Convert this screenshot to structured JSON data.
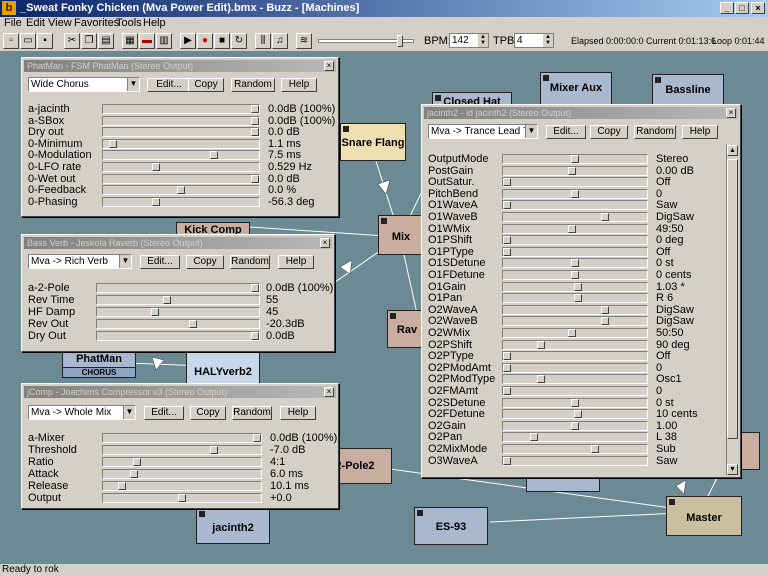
{
  "window": {
    "title": "_Sweat Fonky Chicken (Mva Power Edit).bmx - Buzz - [Machines]"
  },
  "menu": [
    "File",
    "Edit",
    "View",
    "Favorites",
    "Tools",
    "Help"
  ],
  "toolbar": {
    "bpm_label": "BPM:",
    "bpm_value": "142",
    "tpb_label": "TPB:",
    "tpb_value": "4",
    "elapsed": "Elapsed 0:00:00:0",
    "current": "Current 0:01:13:6",
    "loop": "Loop 0:01:44"
  },
  "machines": [
    {
      "name": "Mixer Aux",
      "kind": "gen"
    },
    {
      "name": "Bassline",
      "kind": "gen"
    },
    {
      "name": "Snare Flang",
      "kind": "effect"
    },
    {
      "name": "Mix",
      "kind": "effect"
    },
    {
      "name": "Rav",
      "kind": "effect"
    },
    {
      "name": "Kick Comp",
      "kind": "effect"
    },
    {
      "name": "PhatMan",
      "sub": "CHORUS",
      "kind": "gen"
    },
    {
      "name": "HALYverb2",
      "kind": "effect"
    },
    {
      "name": "2-Pole2",
      "kind": "effect"
    },
    {
      "name": "jacinth2",
      "kind": "gen"
    },
    {
      "name": "ES-93",
      "kind": "gen"
    },
    {
      "name": "Master",
      "kind": "master"
    },
    {
      "name": "Closed Hat",
      "kind": "gen"
    }
  ],
  "dialogs": {
    "phatman": {
      "title": "PhatMan - FSM PhatMan (Stereo Output)",
      "preset": "Wide Chorus",
      "buttons": [
        "Edit...",
        "Copy",
        "Random",
        "Help"
      ],
      "params": [
        {
          "name": "a-jacinth",
          "value": "0.0dB (100%)",
          "pos": 1
        },
        {
          "name": "a-SBox",
          "value": "0.0dB (100%)",
          "pos": 1
        },
        {
          "name": "Dry out",
          "value": "0.0 dB",
          "pos": 1
        },
        {
          "name": "0-Minimum",
          "value": "1.1 ms",
          "pos": 0.04
        },
        {
          "name": "0-Modulation",
          "value": "7.5 ms",
          "pos": 0.72
        },
        {
          "name": "0-LFO rate",
          "value": "0.529 Hz",
          "pos": 0.33
        },
        {
          "name": "0-Wet out",
          "value": "0.0 dB",
          "pos": 1
        },
        {
          "name": "0-Feedback",
          "value": "0.0 %",
          "pos": 0.5
        },
        {
          "name": "0-Phasing",
          "value": "-56.3 deg",
          "pos": 0.33
        }
      ]
    },
    "bassverb": {
      "title": "Bass Verb - Jeskola Raverb (Stereo Output)",
      "preset": "Mva -> Rich Verb",
      "buttons": [
        "Edit...",
        "Copy",
        "Random",
        "Help"
      ],
      "params": [
        {
          "name": "a-2-Pole",
          "value": "0.0dB (100%)",
          "pos": 1
        },
        {
          "name": "Rev Time",
          "value": "55",
          "pos": 0.43
        },
        {
          "name": "HF Damp",
          "value": "45",
          "pos": 0.35
        },
        {
          "name": "Rev Out",
          "value": "-20.3dB",
          "pos": 0.6
        },
        {
          "name": "Dry Out",
          "value": "0.0dB",
          "pos": 1
        }
      ]
    },
    "jcomp": {
      "title": "jComp - Joachims Compressor v3 (Stereo Output)",
      "preset": "Mva -> Whole Mix",
      "buttons": [
        "Edit...",
        "Copy",
        "Random",
        "Help"
      ],
      "params": [
        {
          "name": "a-Mixer",
          "value": "0.0dB (100%)",
          "pos": 1
        },
        {
          "name": "Threshold",
          "value": "-7.0 dB",
          "pos": 0.71
        },
        {
          "name": "Ratio",
          "value": "4:1",
          "pos": 0.2
        },
        {
          "name": "Attack",
          "value": "6.0 ms",
          "pos": 0.18
        },
        {
          "name": "Release",
          "value": "10.1 ms",
          "pos": 0.1
        },
        {
          "name": "Output",
          "value": "+0.0",
          "pos": 0.5
        }
      ]
    },
    "jacinth": {
      "title": "jacinth2 - ld jacinth2 (Stereo Output)",
      "preset": "Mva -> Trance Lead 7",
      "buttons": [
        "Edit...",
        "Copy",
        "Random",
        "Help"
      ],
      "params": [
        {
          "name": "OutputMode",
          "value": "Stereo",
          "pos": 0.5
        },
        {
          "name": "PostGain",
          "value": "0.00 dB",
          "pos": 0.48
        },
        {
          "name": "OutSatur.",
          "value": "Off",
          "pos": 0
        },
        {
          "name": "PitchBend",
          "value": "0",
          "pos": 0.5
        },
        {
          "name": "O1WaveA",
          "value": "Saw",
          "pos": 0
        },
        {
          "name": "O1WaveB",
          "value": "DigSaw",
          "pos": 0.72
        },
        {
          "name": "O1WMix",
          "value": "49:50",
          "pos": 0.48
        },
        {
          "name": "O1PShift",
          "value": "0 deg",
          "pos": 0
        },
        {
          "name": "O1PType",
          "value": "Off",
          "pos": 0
        },
        {
          "name": "O1SDetune",
          "value": "0 st",
          "pos": 0.5
        },
        {
          "name": "O1FDetune",
          "value": "0 cents",
          "pos": 0.5
        },
        {
          "name": "O1Gain",
          "value": "1.03 *",
          "pos": 0.52
        },
        {
          "name": "O1Pan",
          "value": "R 6",
          "pos": 0.52
        },
        {
          "name": "O2WaveA",
          "value": "DigSaw",
          "pos": 0.72
        },
        {
          "name": "O2WaveB",
          "value": "DigSaw",
          "pos": 0.72
        },
        {
          "name": "O2WMix",
          "value": "50:50",
          "pos": 0.48
        },
        {
          "name": "O2PShift",
          "value": "90 deg",
          "pos": 0.25
        },
        {
          "name": "O2PType",
          "value": "Off",
          "pos": 0
        },
        {
          "name": "O2PModAmt",
          "value": "0",
          "pos": 0
        },
        {
          "name": "O2PModType",
          "value": "Osc1",
          "pos": 0.25
        },
        {
          "name": "O2FMAmt",
          "value": "0",
          "pos": 0
        },
        {
          "name": "O2SDetune",
          "value": "0 st",
          "pos": 0.5
        },
        {
          "name": "O2FDetune",
          "value": "10 cents",
          "pos": 0.52
        },
        {
          "name": "O2Gain",
          "value": "1.00",
          "pos": 0.5
        },
        {
          "name": "O2Pan",
          "value": "L 38",
          "pos": 0.2
        },
        {
          "name": "O2MixMode",
          "value": "Sub",
          "pos": 0.65
        },
        {
          "name": "O3WaveA",
          "value": "Saw",
          "pos": 0
        }
      ]
    }
  },
  "status": "Ready to rok"
}
